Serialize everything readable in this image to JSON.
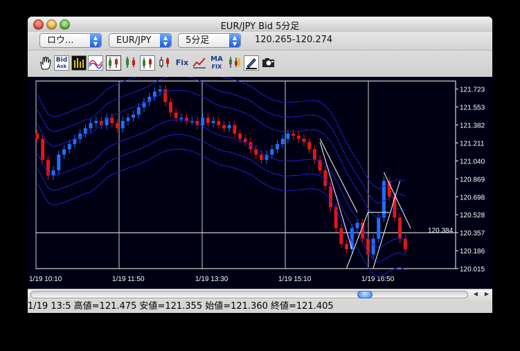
{
  "window": {
    "title": "EUR/JPY Bid 5分足"
  },
  "controls": {
    "dropdown_type": "ロウ...",
    "dropdown_pair": "EUR/JPY",
    "dropdown_period": "5分足",
    "price_range": "120.265-120.274"
  },
  "toolbar": {
    "items": [
      {
        "name": "hand-tool-icon",
        "label": ""
      },
      {
        "name": "bid-ask-icon",
        "label": "Bid"
      },
      {
        "name": "volume-chart-icon",
        "label": ""
      },
      {
        "name": "wave-chart-icon",
        "label": ""
      },
      {
        "name": "candle-chart-1-icon",
        "label": ""
      },
      {
        "name": "candle-chart-2-icon",
        "label": ""
      },
      {
        "name": "candle-chart-3-icon",
        "label": ""
      },
      {
        "name": "candle-chart-4-icon",
        "label": ""
      },
      {
        "name": "fix-icon",
        "label": "Fix"
      },
      {
        "name": "trend-line-icon",
        "label": ""
      },
      {
        "name": "ma-fix-icon",
        "label": "MA"
      },
      {
        "name": "signal-icon",
        "label": ""
      },
      {
        "name": "pen-icon",
        "label": ""
      },
      {
        "name": "camera-icon",
        "label": ""
      }
    ]
  },
  "colors": {
    "bull": "#1e6fff",
    "bear": "#e01818",
    "band": "#2020c8",
    "grid": "#ffffff",
    "background": "#000014"
  },
  "chart_data": {
    "type": "candlestick",
    "title": "",
    "xlabel": "",
    "ylabel": "",
    "ylim": [
      120.015,
      121.8
    ],
    "y_ticks": [
      "121.723",
      "121.553",
      "121.382",
      "121.211",
      "121.040",
      "120.869",
      "120.698",
      "120.528",
      "120.357",
      "120.186",
      "120.015"
    ],
    "x_ticks": [
      "1/19 10:10",
      "1/19 11:50",
      "1/19 13:30",
      "1/19 15:10",
      "1/19 16:50"
    ],
    "current_price_label": "120.384",
    "current_price": 120.384,
    "grid": true,
    "candles_close": [
      121.25,
      121.05,
      120.9,
      120.95,
      121.1,
      121.15,
      121.2,
      121.25,
      121.3,
      121.35,
      121.4,
      121.42,
      121.38,
      121.45,
      121.4,
      121.35,
      121.42,
      121.45,
      121.48,
      121.55,
      121.6,
      121.65,
      121.7,
      121.72,
      121.6,
      121.5,
      121.45,
      121.45,
      121.42,
      121.42,
      121.38,
      121.45,
      121.4,
      121.42,
      121.38,
      121.35,
      121.38,
      121.3,
      121.25,
      121.22,
      121.15,
      121.1,
      121.05,
      121.1,
      121.15,
      121.2,
      121.25,
      121.3,
      121.28,
      121.25,
      121.22,
      121.15,
      121.05,
      120.95,
      120.8,
      120.6,
      120.4,
      120.25,
      120.2,
      120.4,
      120.45,
      120.3,
      120.15,
      120.3,
      120.5,
      120.85,
      120.7,
      120.5,
      120.3,
      120.2
    ]
  },
  "status": {
    "text": "1/19 13:5  高値=121.475 安値=121.355 始値=121.360 終値=121.405"
  }
}
